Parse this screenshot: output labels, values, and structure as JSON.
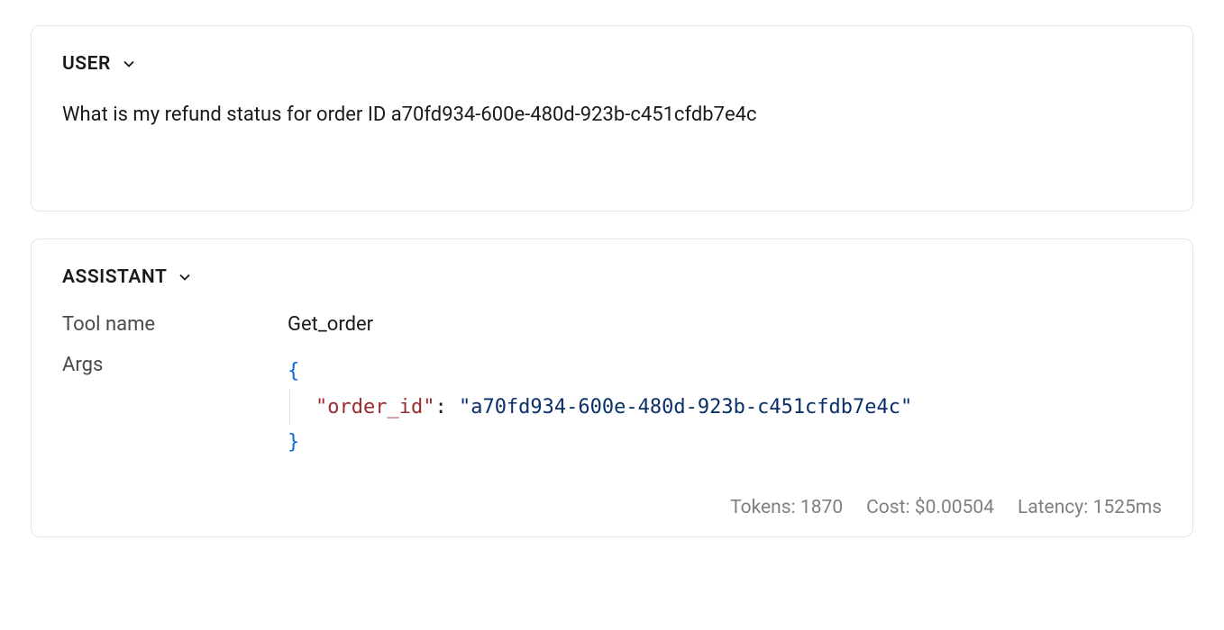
{
  "user_message": {
    "role_label": "USER",
    "content": "What is my refund status for order ID a70fd934-600e-480d-923b-c451cfdb7e4c"
  },
  "assistant_message": {
    "role_label": "ASSISTANT",
    "tool_name_label": "Tool name",
    "tool_name_value": "Get_order",
    "args_label": "Args",
    "args": {
      "key": "\"order_id\"",
      "value": "\"a70fd934-600e-480d-923b-c451cfdb7e4c\""
    },
    "stats": {
      "tokens_label": "Tokens:",
      "tokens_value": "1870",
      "cost_label": "Cost:",
      "cost_value": "$0.00504",
      "latency_label": "Latency:",
      "latency_value": "1525ms"
    }
  }
}
